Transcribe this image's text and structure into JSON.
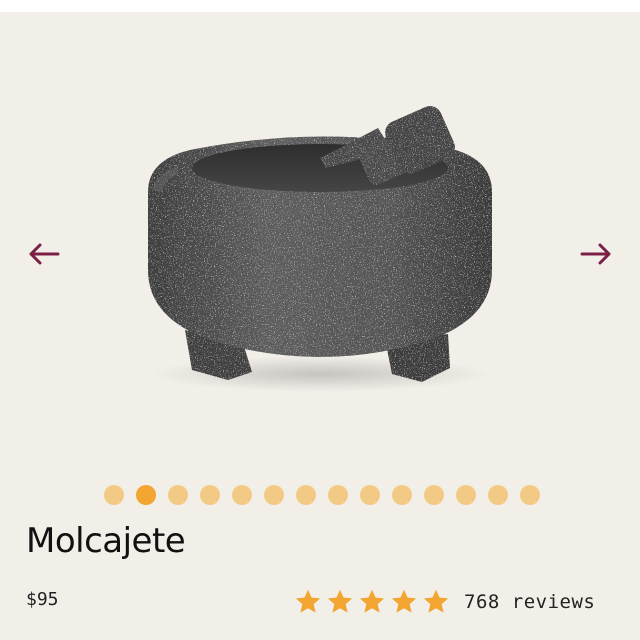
{
  "product": {
    "title": "Molcajete",
    "price": "$95",
    "rating": {
      "stars": 5,
      "max_stars": 5,
      "reviews_label": "768 reviews"
    },
    "image_subject": "molcajete-stone-mortar-and-pestle"
  },
  "carousel": {
    "total_slides": 14,
    "active_index": 1,
    "prev_icon": "arrow-left-icon",
    "next_icon": "arrow-right-icon"
  },
  "colors": {
    "card_background": "#f2efe9",
    "arrow": "#7a1f45",
    "dot_active": "#f2a531",
    "dot_inactive": "#f2ca84",
    "star": "#f2a531",
    "text": "#111111"
  }
}
